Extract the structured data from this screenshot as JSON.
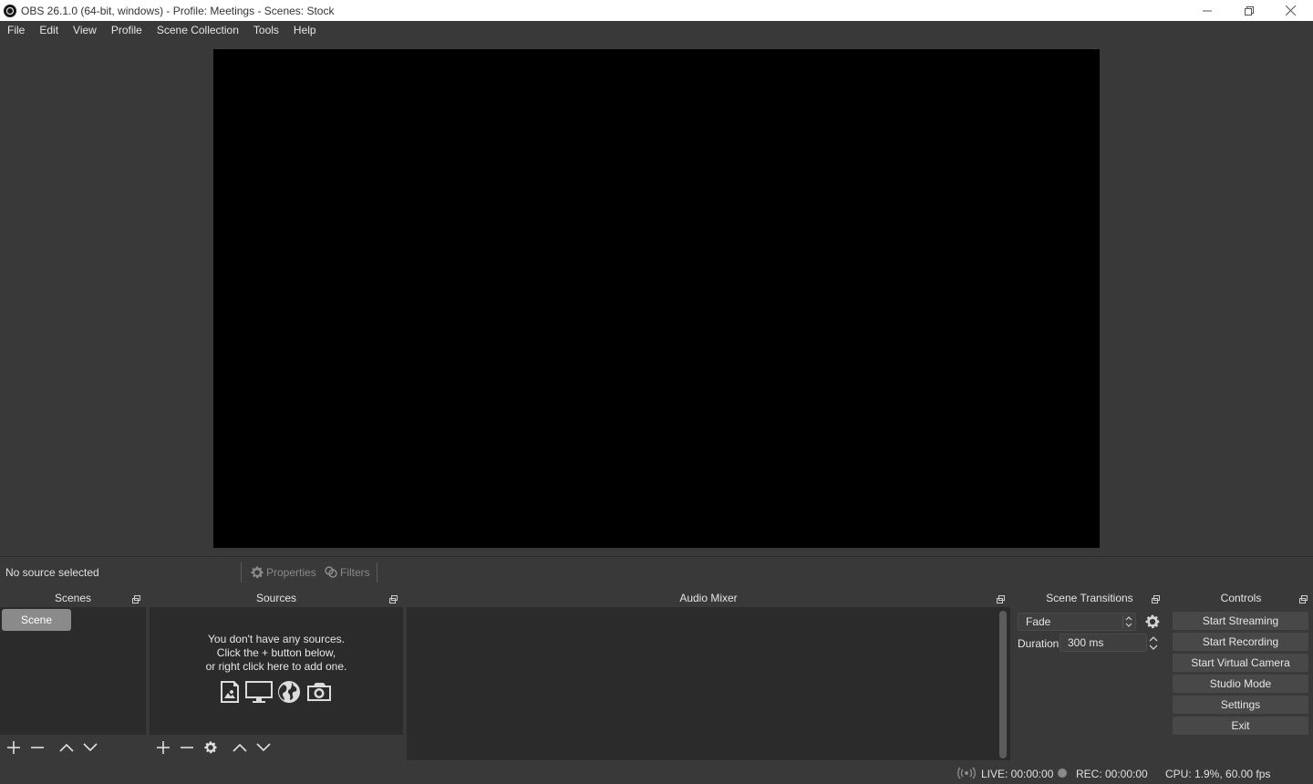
{
  "window": {
    "title": "OBS 26.1.0 (64-bit, windows) - Profile: Meetings - Scenes: Stock"
  },
  "menu": [
    "File",
    "Edit",
    "View",
    "Profile",
    "Scene Collection",
    "Tools",
    "Help"
  ],
  "source_toolbar": {
    "status": "No source selected",
    "properties_label": "Properties",
    "filters_label": "Filters"
  },
  "docks": {
    "scenes": {
      "title": "Scenes",
      "items": [
        "Scene"
      ]
    },
    "sources": {
      "title": "Sources",
      "empty_line1": "You don't have any sources.",
      "empty_line2": "Click the + button below,",
      "empty_line3": "or right click here to add one."
    },
    "audio_mixer": {
      "title": "Audio Mixer"
    },
    "scene_transitions": {
      "title": "Scene Transitions",
      "transition": "Fade",
      "duration_label": "Duration",
      "duration_value": "300 ms"
    },
    "controls": {
      "title": "Controls",
      "buttons": [
        "Start Streaming",
        "Start Recording",
        "Start Virtual Camera",
        "Studio Mode",
        "Settings",
        "Exit"
      ]
    }
  },
  "status": {
    "live": "LIVE: 00:00:00",
    "rec": "REC: 00:00:00",
    "cpu": "CPU: 1.9%, 60.00 fps"
  },
  "colors": {
    "background": "#3a393a",
    "dock_body": "#2b2b2b",
    "preview": "#000000",
    "selected_scene": "#8a8a8a"
  }
}
